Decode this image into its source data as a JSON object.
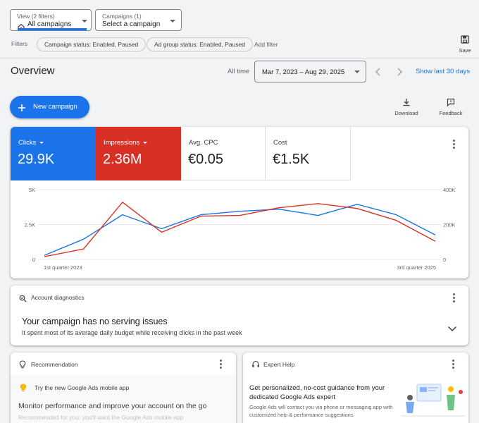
{
  "filters_bar": {
    "view": {
      "small": "View (2 filters)",
      "value": "All campaigns"
    },
    "campaigns": {
      "small": "Campaigns (1)",
      "value": "Select a campaign"
    },
    "save_label": "Save",
    "filters_label": "Filters",
    "chips": [
      "Campaign status: Enabled, Paused",
      "Ad group status: Enabled, Paused"
    ],
    "add_filter": "Add filter"
  },
  "header": {
    "title": "Overview",
    "all_time": "All time",
    "date_range": "Mar 7, 2023 – Aug 29, 2025",
    "show_last": "Show last 30 days"
  },
  "actions": {
    "new_campaign": "New campaign",
    "download": "Download",
    "feedback": "Feedback"
  },
  "metrics": [
    {
      "label": "Clicks",
      "value": "29.9K",
      "color": "#1a73e8"
    },
    {
      "label": "Impressions",
      "value": "2.36M",
      "color": "#d93025"
    },
    {
      "label": "Avg. CPC",
      "value": "€0.05"
    },
    {
      "label": "Cost",
      "value": "€1.5K"
    }
  ],
  "chart_data": {
    "type": "line",
    "x": [
      "1st quarter 2023",
      "2nd quarter 2023",
      "3rd quarter 2023",
      "4th quarter 2023",
      "1st quarter 2024",
      "2nd quarter 2024",
      "3rd quarter 2024",
      "4th quarter 2024",
      "1st quarter 2025",
      "2nd quarter 2025",
      "3rd quarter 2025"
    ],
    "x_tick_labels": [
      "1st quarter 2023",
      "3rd quarter 2025"
    ],
    "left_axis": {
      "ticks": [
        "0",
        "2.5K",
        "5K"
      ],
      "range": [
        0,
        5000
      ]
    },
    "right_axis": {
      "ticks": [
        "0",
        "200K",
        "400K"
      ],
      "range": [
        0,
        400000
      ]
    },
    "series": [
      {
        "name": "Clicks",
        "color": "#1a73e8",
        "axis": "left",
        "values": [
          300,
          1450,
          3200,
          2200,
          3200,
          3450,
          3600,
          3150,
          3950,
          3200,
          1750
        ]
      },
      {
        "name": "Impressions",
        "color": "#d93025",
        "axis": "left",
        "values": [
          200,
          750,
          4100,
          1950,
          3100,
          3150,
          3700,
          4000,
          3650,
          2800,
          1300
        ]
      }
    ],
    "grid": true
  },
  "diagnostics": {
    "header": "Account diagnostics",
    "title": "Your campaign has no serving issues",
    "subtitle": "It spent most of its average daily budget while receiving clicks in the past week"
  },
  "recommendation": {
    "header": "Recommendation",
    "tip": "Try the new Google Ads mobile app",
    "title": "Monitor performance and improve your account on the go",
    "body": "Recommended for you: you'll want the Google Ads mobile app"
  },
  "expert_help": {
    "header": "Expert Help",
    "title": "Get personalized, no-cost guidance from your dedicated Google Ads expert",
    "body": "Google Ads will contact you via phone or messaging app with customized help & performance suggestions"
  }
}
